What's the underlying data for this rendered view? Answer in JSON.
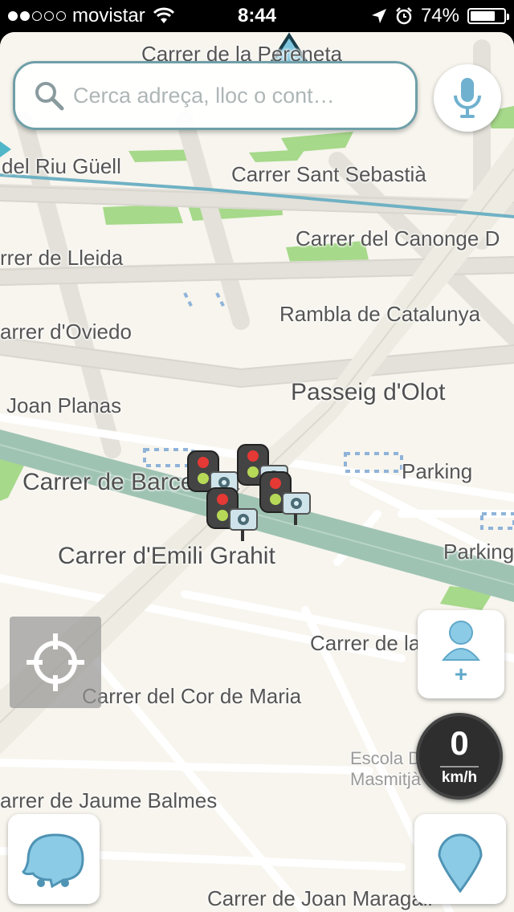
{
  "status_bar": {
    "carrier": "movistar",
    "signal_bars_filled": 2,
    "signal_bars_total": 5,
    "time": "8:44",
    "battery_percent": "74%",
    "battery_level": 0.74,
    "icons": [
      "wifi-icon",
      "location-arrow-icon",
      "alarm-icon",
      "battery-icon"
    ]
  },
  "search": {
    "placeholder": "Cerca adreça, lloc o cont…",
    "icon": "search-icon"
  },
  "map": {
    "streets": [
      "Carrer de la Pereneta",
      "del Riu Güell",
      "Carrer Sant Sebastià",
      "Carrer del Canonge D",
      "rrer de Lleida",
      "Rambla de Catalunya",
      "arrer d'Oviedo",
      "Passeig d'Olot",
      "Joan Planas",
      "Carrer de Barcelona",
      "Parking",
      "Carrer d'Emili Grahit",
      "Parking",
      "Carrer de la Creu",
      "Carrer del Cor de Maria",
      "Escola Dr. Masmitjà",
      "arrer de Jaume Balmes",
      "Carrer de Joan Maragall"
    ],
    "alerts": [
      "traffic-light-camera",
      "traffic-light-camera",
      "traffic-light-camera",
      "traffic-light-camera"
    ]
  },
  "speedometer": {
    "value": "0",
    "unit": "km/h"
  },
  "buttons": {
    "share_plus": "+"
  },
  "colors": {
    "map_bg": "#f7f5ee",
    "park": "#a6d98a",
    "main_road": "#9fc3b3",
    "accent": "#6fb1cf"
  }
}
